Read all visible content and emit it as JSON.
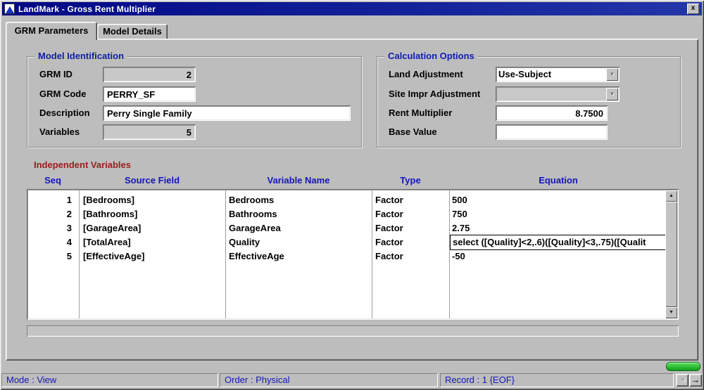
{
  "window": {
    "title": "LandMark - Gross Rent Multiplier"
  },
  "icons": {
    "close": "x",
    "combo_arrow": "▼",
    "scroll_up": "▲",
    "scroll_down": "▼",
    "nav_left": "◄",
    "nav_right": "→"
  },
  "tabs": {
    "grm_parameters": "GRM Parameters",
    "model_details": "Model Details"
  },
  "model_identification": {
    "title": "Model Identification",
    "grm_id_label": "GRM ID",
    "grm_id_value": "2",
    "grm_code_label": "GRM Code",
    "grm_code_value": "PERRY_SF",
    "description_label": "Description",
    "description_value": "Perry Single Family",
    "variables_label": "Variables",
    "variables_value": "5"
  },
  "calculation_options": {
    "title": "Calculation Options",
    "land_adjustment_label": "Land Adjustment",
    "land_adjustment_value": "Use-Subject",
    "site_impr_label": "Site Impr Adjustment",
    "site_impr_value": "",
    "rent_multiplier_label": "Rent Multiplier",
    "rent_multiplier_value": "8.7500",
    "base_value_label": "Base Value",
    "base_value_value": ""
  },
  "independent_variables": {
    "title": "Independent Variables",
    "columns": [
      "Seq",
      "Source Field",
      "Variable Name",
      "Type",
      "Equation"
    ],
    "rows": [
      {
        "seq": "1",
        "source": "[Bedrooms]",
        "variable": "Bedrooms",
        "type": "Factor",
        "equation": "500"
      },
      {
        "seq": "2",
        "source": "[Bathrooms]",
        "variable": "Bathrooms",
        "type": "Factor",
        "equation": "750"
      },
      {
        "seq": "3",
        "source": "[GarageArea]",
        "variable": "GarageArea",
        "type": "Factor",
        "equation": "2.75"
      },
      {
        "seq": "4",
        "source": "[TotalArea]",
        "variable": "Quality",
        "type": "Factor",
        "equation": "select ([Quality]<2,.6)([Quality]<3,.75)([Qualit"
      },
      {
        "seq": "5",
        "source": "[EffectiveAge]",
        "variable": "EffectiveAge",
        "type": "Factor",
        "equation": "-50"
      }
    ]
  },
  "status_bar": {
    "mode": "Mode : View",
    "order": "Order : Physical",
    "record": "Record : 1 {EOF}"
  },
  "colors": {
    "window_bg": "#bdbdbd",
    "title_start": "#000785",
    "title_end": "#2336a8",
    "group_title": "#0f1ea8",
    "section_title": "#9b1c1c",
    "table_header": "#1515bb",
    "status_text": "#1515bb",
    "field_bg_disabled": "#c8c8c8",
    "green_light": "#5ce05c",
    "green_dark": "#0f9f1f"
  }
}
